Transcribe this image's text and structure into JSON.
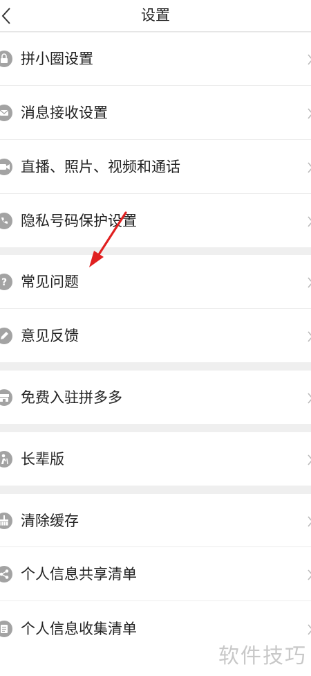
{
  "header": {
    "title": "设置"
  },
  "menu": [
    {
      "label": "拼小圈设置",
      "icon": "lock-icon"
    },
    {
      "label": "消息接收设置",
      "icon": "message-icon"
    },
    {
      "label": "直播、照片、视频和通话",
      "icon": "video-icon"
    },
    {
      "label": "隐私号码保护设置",
      "icon": "phone-shield-icon"
    },
    {
      "label": "常见问题",
      "icon": "question-icon"
    },
    {
      "label": "意见反馈",
      "icon": "edit-icon"
    },
    {
      "label": "免费入驻拼多多",
      "icon": "store-icon"
    },
    {
      "label": "长辈版",
      "icon": "elder-icon"
    },
    {
      "label": "清除缓存",
      "icon": "broom-icon"
    },
    {
      "label": "个人信息共享清单",
      "icon": "share-icon"
    },
    {
      "label": "个人信息收集清单",
      "icon": "list-icon"
    }
  ],
  "watermark": "软件技巧",
  "colors": {
    "icon": "#a3a3a3",
    "annotation_arrow": "#e02020"
  }
}
